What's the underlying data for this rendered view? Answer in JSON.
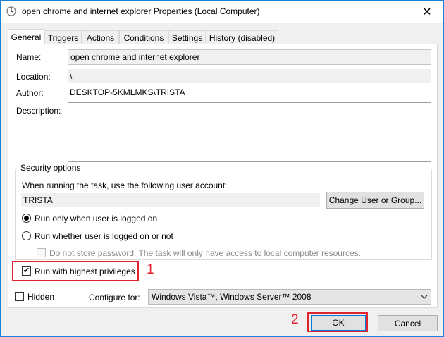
{
  "window": {
    "title": "open chrome and internet explorer Properties (Local Computer)",
    "close_glyph": "✕"
  },
  "tabs": [
    "General",
    "Triggers",
    "Actions",
    "Conditions",
    "Settings",
    "History (disabled)"
  ],
  "general": {
    "name_label": "Name:",
    "name_value": "open chrome and internet explorer",
    "location_label": "Location:",
    "location_value": "\\",
    "author_label": "Author:",
    "author_value": "DESKTOP-5KMLMKS\\TRISTA",
    "description_label": "Description:"
  },
  "security": {
    "group_title": "Security options",
    "account_prompt": "When running the task, use the following user account:",
    "account_value": "TRISTA",
    "change_button": "Change User or Group...",
    "radio_logged_on": "Run only when user is logged on",
    "radio_logged_on_or_not": "Run whether user is logged on or not",
    "dont_store_password": "Do not store password.  The task will only have access to local computer resources.",
    "highest_privileges": "Run with highest privileges",
    "selected_radio": "logged_on",
    "highest_privileges_checked": true,
    "dont_store_checked": false
  },
  "footer": {
    "hidden_label": "Hidden",
    "hidden_checked": false,
    "configure_label": "Configure for:",
    "configure_value": "Windows Vista™, Windows Server™ 2008",
    "ok_button": "OK",
    "cancel_button": "Cancel"
  },
  "annotations": {
    "marker_1": "1",
    "marker_2": "2",
    "highlight_color": "#e0242f"
  },
  "icons": {
    "title": "task-scheduler-clock-icon",
    "chevron": "chevron-down-icon",
    "check": "✔"
  }
}
